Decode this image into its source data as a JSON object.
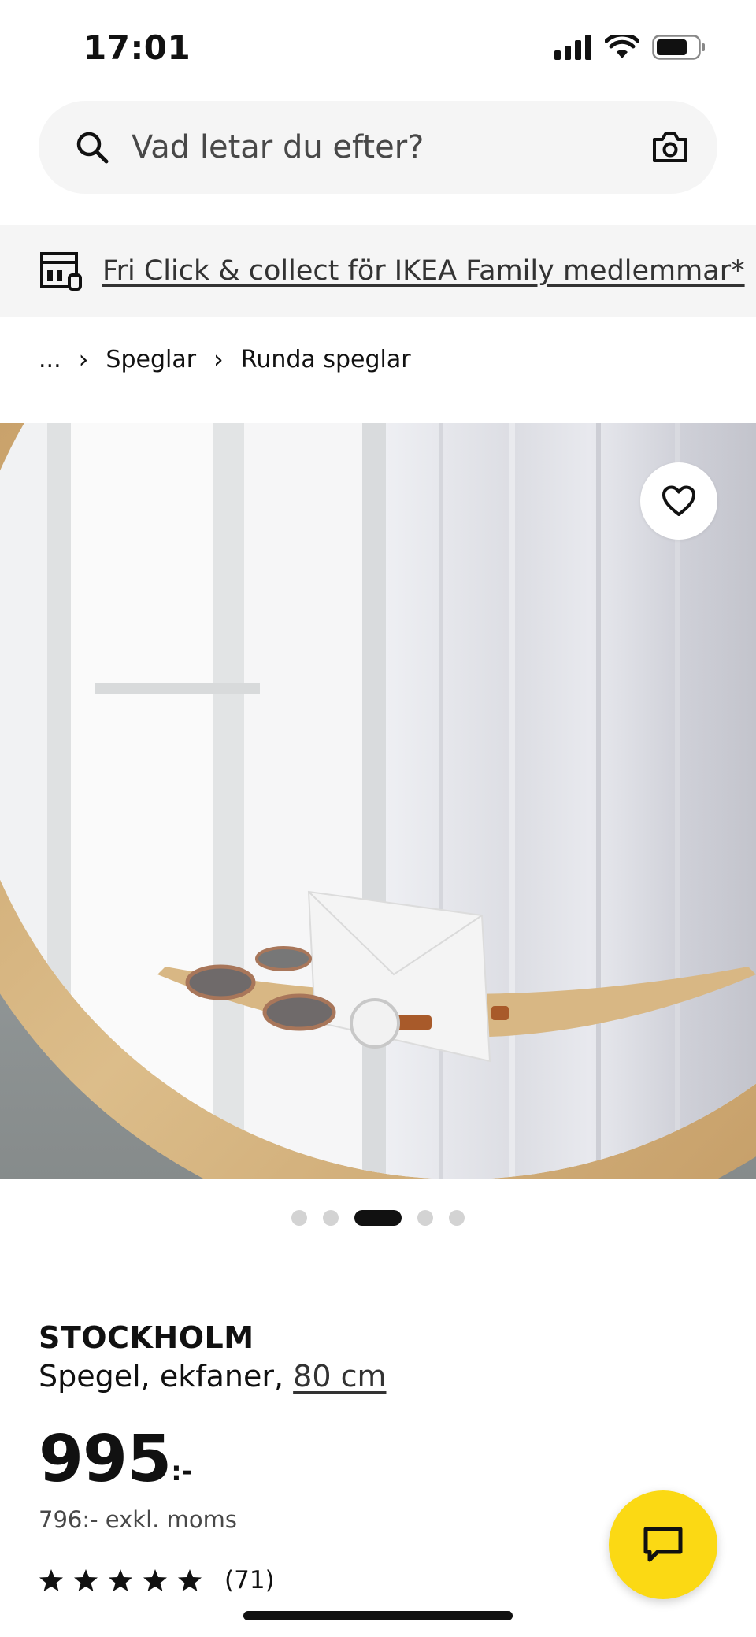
{
  "status_bar": {
    "time": "17:01"
  },
  "search": {
    "placeholder": "Vad letar du efter?"
  },
  "promo": {
    "text": "Fri Click & collect för IKEA Family medlemmar*"
  },
  "breadcrumb": {
    "items": [
      "...",
      "Speglar",
      "Runda speglar"
    ]
  },
  "carousel": {
    "total": 5,
    "active_index": 2
  },
  "product": {
    "name": "STOCKHOLM",
    "description": "Spegel, ekfaner, ",
    "size": "80 cm",
    "price": "995",
    "price_suffix": ":-",
    "price_ex_vat": "796:- exkl. moms",
    "rating": 5,
    "review_count": "(71)"
  },
  "icons": [
    "search-icon",
    "camera-icon",
    "store-icon",
    "heart-icon",
    "star-icon",
    "chat-icon",
    "signal-icon",
    "wifi-icon",
    "battery-icon"
  ],
  "colors": {
    "accent_yellow": "#fbd914",
    "surface_gray": "#f5f5f5"
  }
}
